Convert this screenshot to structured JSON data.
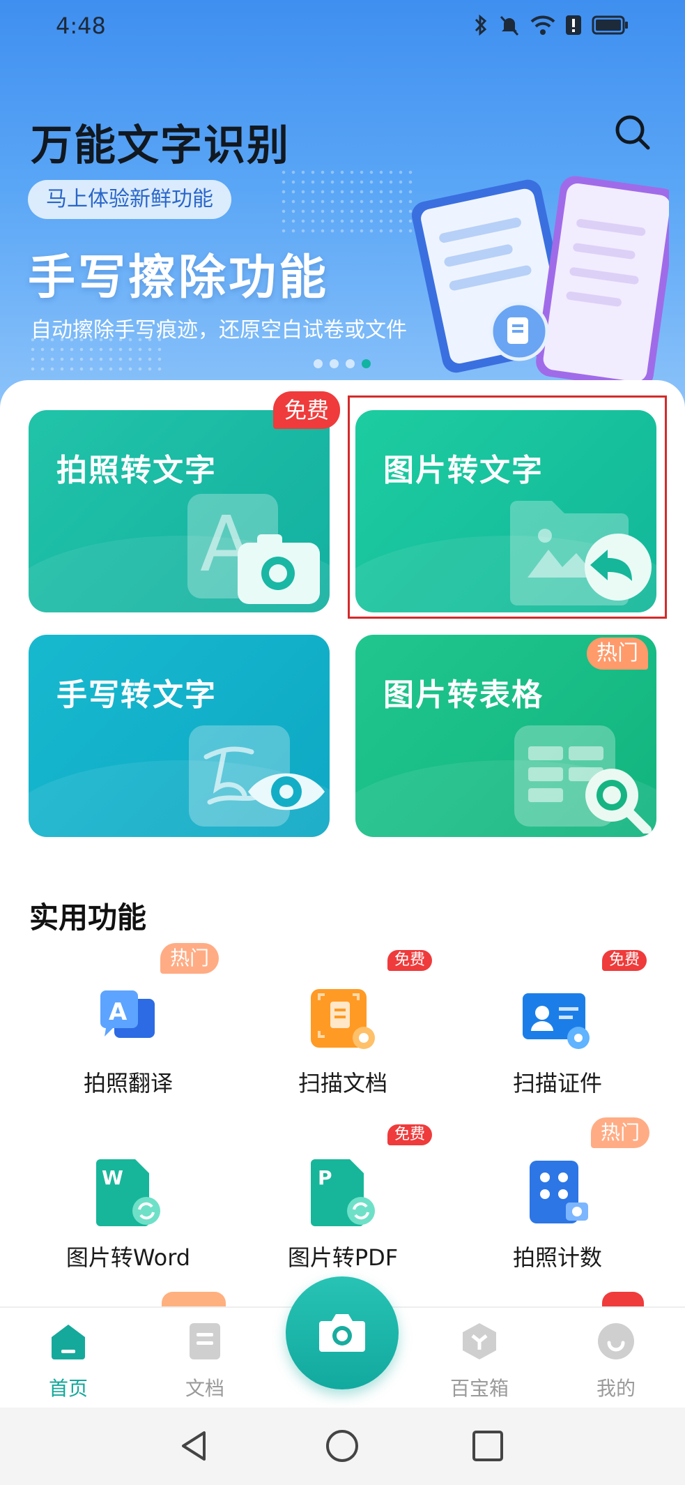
{
  "status_bar": {
    "time": "4:48",
    "icons": [
      "bluetooth-icon",
      "mute-icon",
      "wifi-icon",
      "alert-icon",
      "battery-icon"
    ]
  },
  "header": {
    "title": "万能文字识别"
  },
  "banner": {
    "pill": "马上体验新鲜功能",
    "headline": "手写擦除功能",
    "subtitle": "自动擦除手写痕迹，还原空白试卷或文件",
    "page_count": 4,
    "active_page": 4
  },
  "main_tiles": [
    {
      "label": "拍照转文字",
      "badge": "免费"
    },
    {
      "label": "图片转文字",
      "badge": ""
    },
    {
      "label": "手写转文字",
      "badge": ""
    },
    {
      "label": "图片转表格",
      "badge": "热门"
    }
  ],
  "practical": {
    "title": "实用功能",
    "items": [
      {
        "label": "拍照翻译",
        "badge": "热门"
      },
      {
        "label": "扫描文档",
        "badge": "免费"
      },
      {
        "label": "扫描证件",
        "badge": "免费"
      },
      {
        "label": "图片转Word",
        "badge": ""
      },
      {
        "label": "图片转PDF",
        "badge": "免费"
      },
      {
        "label": "拍照计数",
        "badge": "热门"
      }
    ]
  },
  "bottom_nav": {
    "items": [
      {
        "label": "首页",
        "icon": "home-icon",
        "active": true
      },
      {
        "label": "文档",
        "icon": "document-icon",
        "active": false
      },
      {
        "label": "",
        "icon": "camera-icon",
        "active": false
      },
      {
        "label": "百宝箱",
        "icon": "toolbox-icon",
        "active": false
      },
      {
        "label": "我的",
        "icon": "profile-icon",
        "active": false
      }
    ]
  },
  "colors": {
    "accent": "#13a89a",
    "badge_free": "#ef3b3b",
    "badge_hot": "#ff9a6a",
    "highlight": "#d42a2a"
  }
}
